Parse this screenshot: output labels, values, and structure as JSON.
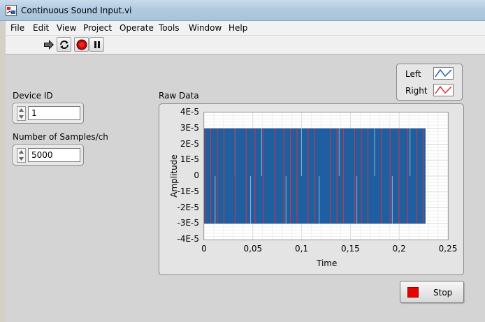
{
  "window": {
    "title": "Continuous Sound Input.vi"
  },
  "menu": [
    "File",
    "Edit",
    "View",
    "Project",
    "Operate",
    "Tools",
    "Window",
    "Help"
  ],
  "toolbar": {
    "icons": [
      "run-arrow-icon",
      "run-continuously-icon",
      "abort-execution-icon",
      "pause-icon"
    ]
  },
  "controls": {
    "device_id": {
      "label": "Device ID",
      "value": "1"
    },
    "samples": {
      "label": "Number of Samples/ch",
      "value": "5000"
    }
  },
  "legend": {
    "items": [
      {
        "name": "Left",
        "color": "#1f5fa0"
      },
      {
        "name": "Right",
        "color": "#e0303a"
      }
    ]
  },
  "stop_button": {
    "label": "Stop",
    "led_color": "#e60000"
  },
  "chart_data": {
    "type": "line",
    "title": "Raw Data",
    "xlabel": "Time",
    "ylabel": "Amplitude",
    "xlim": [
      0,
      0.25
    ],
    "ylim": [
      -4e-05,
      4e-05
    ],
    "x_ticks": [
      "0",
      "0,05",
      "0,1",
      "0,15",
      "0,2",
      "0,25"
    ],
    "y_ticks": [
      "4E-5",
      "3E-5",
      "2E-5",
      "1E-5",
      "0",
      "-1E-5",
      "-2E-5",
      "-3E-5",
      "-4E-5"
    ],
    "grid": true,
    "series": [
      {
        "name": "Left",
        "color": "#1f5fa0",
        "x_range": [
          0,
          0.227
        ],
        "min": -3e-05,
        "max": 3e-05,
        "pattern": "square-wave"
      },
      {
        "name": "Right",
        "color": "#e0303a",
        "x_range": [
          0,
          0.227
        ],
        "min": -3e-05,
        "max": 3e-05,
        "pattern": "square-wave"
      }
    ]
  }
}
